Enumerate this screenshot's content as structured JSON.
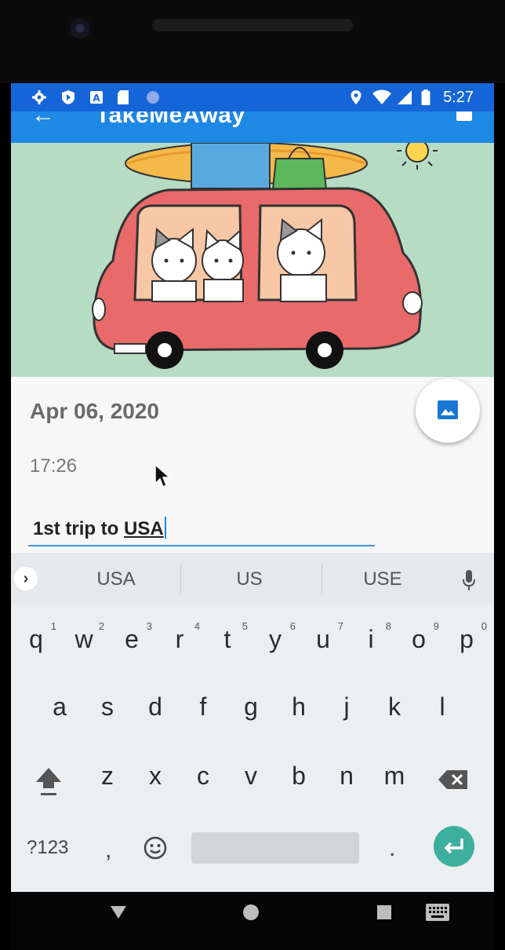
{
  "status_bar": {
    "time": "5:27",
    "left_icons": [
      "settings-icon",
      "shield-icon",
      "a-icon",
      "sd-card-icon",
      "circle-icon"
    ],
    "right_icons": [
      "location-icon",
      "wifi-icon",
      "signal-icon",
      "battery-icon"
    ]
  },
  "app_bar": {
    "title": "TakeMeAway",
    "back_icon": "arrow-back-icon",
    "action_icon": "save-icon",
    "color": "#1e88e5"
  },
  "entry": {
    "date": "Apr 06, 2020",
    "time": "17:26",
    "note_prefix": "1st trip to ",
    "note_word": "USA",
    "fab_icon": "image-icon"
  },
  "keyboard": {
    "suggestions": [
      "USA",
      "US",
      "USE"
    ],
    "row1": [
      {
        "key": "q",
        "hint": "1"
      },
      {
        "key": "w",
        "hint": "2"
      },
      {
        "key": "e",
        "hint": "3"
      },
      {
        "key": "r",
        "hint": "4"
      },
      {
        "key": "t",
        "hint": "5"
      },
      {
        "key": "y",
        "hint": "6"
      },
      {
        "key": "u",
        "hint": "7"
      },
      {
        "key": "i",
        "hint": "8"
      },
      {
        "key": "o",
        "hint": "9"
      },
      {
        "key": "p",
        "hint": "0"
      }
    ],
    "row2": [
      "a",
      "s",
      "d",
      "f",
      "g",
      "h",
      "j",
      "k",
      "l"
    ],
    "row3": [
      "z",
      "x",
      "c",
      "v",
      "b",
      "n",
      "m"
    ],
    "symbols_label": "?123",
    "comma": ",",
    "period": ".",
    "accent_color": "#3daf9e"
  },
  "nav_bar": {
    "icons": [
      "back-triangle-icon",
      "home-circle-icon",
      "recents-square-icon",
      "keyboard-switch-icon"
    ]
  }
}
